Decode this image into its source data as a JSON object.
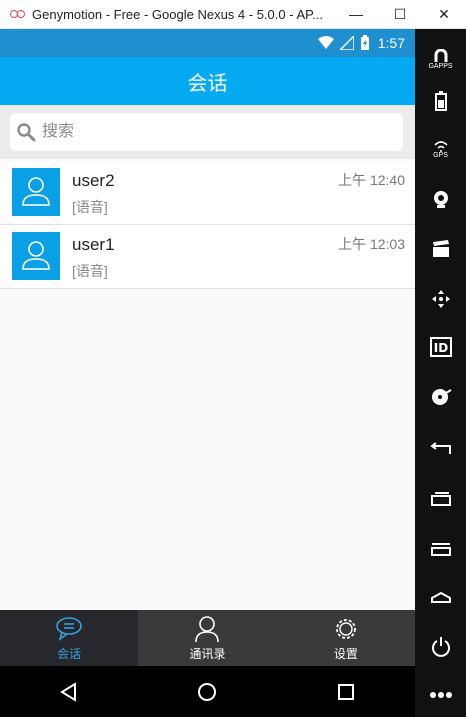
{
  "window": {
    "title": "Genymotion - Free - Google Nexus 4 - 5.0.0 - AP...",
    "minimize": "—",
    "maximize": "☐",
    "close": "✕"
  },
  "statusbar": {
    "time": "1:57"
  },
  "appbar": {
    "title": "会话"
  },
  "search": {
    "placeholder": "搜索"
  },
  "conversations": [
    {
      "name": "user2",
      "preview": "[语音]",
      "time": "上午 12:40"
    },
    {
      "name": "user1",
      "preview": "[语音]",
      "time": "上午 12:03"
    }
  ],
  "tabs": [
    {
      "label": "会话",
      "icon": "chat-icon",
      "active": true
    },
    {
      "label": "通讯录",
      "icon": "contacts-icon",
      "active": false
    },
    {
      "label": "设置",
      "icon": "settings-icon",
      "active": false
    }
  ],
  "sidebar": {
    "gapps": "GAPPS",
    "gps": "GPS"
  },
  "colors": {
    "accent": "#06aaf3",
    "statusbar": "#1f8fd0",
    "tab_active": "#34a0dd",
    "avatar": "#0b9fe6"
  }
}
